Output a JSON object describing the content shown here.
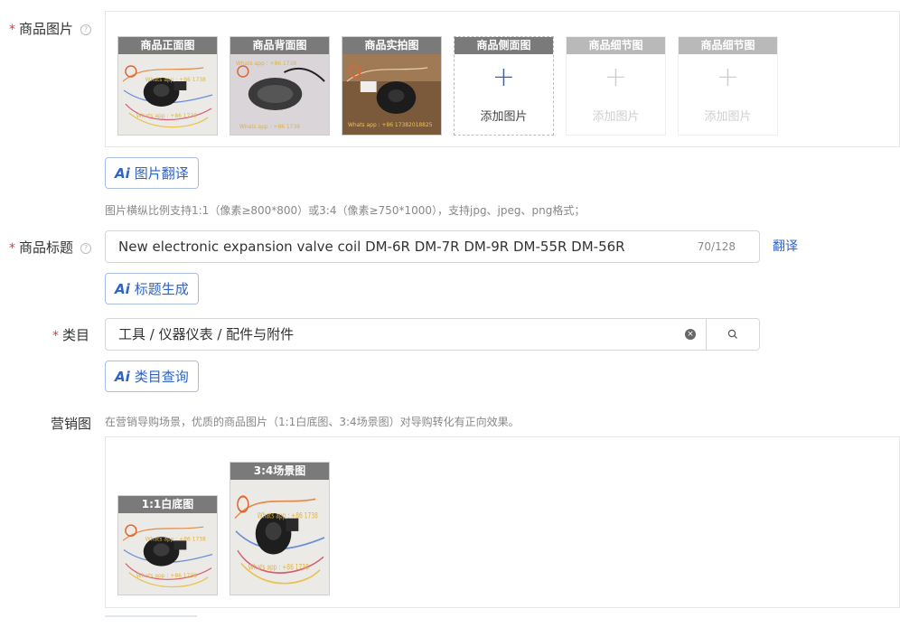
{
  "product_images": {
    "label": "商品图片",
    "required_mark": "*",
    "help_icon": "?",
    "slots": [
      {
        "title": "商品正面图",
        "state": "filled"
      },
      {
        "title": "商品背面图",
        "state": "filled"
      },
      {
        "title": "商品实拍图",
        "state": "filled"
      },
      {
        "title": "商品侧面图",
        "state": "add",
        "add_label": "添加图片"
      },
      {
        "title": "商品细节图",
        "state": "disabled",
        "add_label": "添加图片"
      },
      {
        "title": "商品细节图",
        "state": "disabled",
        "add_label": "添加图片"
      }
    ],
    "ai_button": "图片翻译",
    "hint": "图片横纵比例支持1:1（像素≥800*800）或3:4（像素≥750*1000），支持jpg、jpeg、png格式；"
  },
  "product_title": {
    "label": "商品标题",
    "required_mark": "*",
    "help_icon": "?",
    "value": "New electronic expansion valve coil   DM-6R DM-7R DM-9R  DM-55R DM-56R",
    "counter": "70/128",
    "translate_link": "翻译",
    "ai_button": "标题生成"
  },
  "category": {
    "label": "类目",
    "required_mark": "*",
    "value": "工具 / 仪器仪表 / 配件与附件",
    "clear_icon": "×",
    "ai_button": "类目查询"
  },
  "marketing": {
    "label": "营销图",
    "hint": "在营销导购场景，优质的商品图片（1:1白底图、3:4场景图）对导购转化有正向效果。",
    "images": [
      {
        "title": "1:1白底图"
      },
      {
        "title": "3:4场景图"
      }
    ]
  },
  "ai_logo": "Ai",
  "plus_glyph": "+",
  "colors": {
    "accent": "#2f63c4",
    "required": "#e4393c",
    "thumb_header": "#7a7a7a",
    "thumb_header_disabled": "#b9b9b9"
  }
}
